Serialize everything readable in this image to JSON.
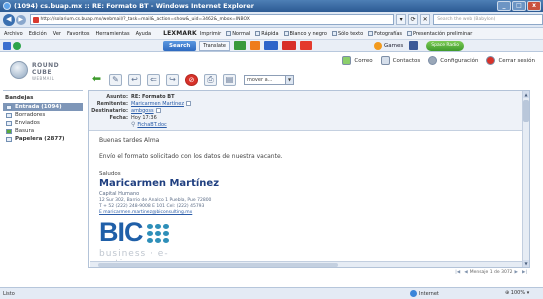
{
  "window": {
    "title": "(1094) cs.buap.mx :: RE: Formato BT - Windows Internet Explorer",
    "controls": [
      "_",
      "□",
      "x"
    ]
  },
  "address": {
    "url": "http://solarium.cs.buap.mx/webmail/?_task=mail&_action=show&_uid=3462&_mbox=INBOX",
    "search_placeholder": "Search the web (Babylon)"
  },
  "menu": {
    "items": [
      "Archivo",
      "Edición",
      "Ver",
      "Favoritos",
      "Herramientas",
      "Ayuda"
    ],
    "lexmark": "LEXMARK",
    "tools": [
      "Imprimir",
      "Normal",
      "Rápida",
      "Blanco y negro",
      "Sólo texto",
      "Fotografías",
      "Presentación preliminar"
    ]
  },
  "toolbar2": {
    "search_label": "Search",
    "translate_label": "Translate",
    "games_label": "Games",
    "radio_label": "Space Radio"
  },
  "webmail": {
    "logo_line1": "ROUND",
    "logo_line2": "CUBE",
    "logo_line3": "WEBMAIL",
    "nav": [
      "Correo",
      "Contactos",
      "Configuración",
      "Cerrar sesión"
    ],
    "move_placeholder": "mover a...",
    "folders_title": "Bandejas",
    "folders": [
      {
        "label": "Entrada (1094)",
        "selected": true,
        "bold": true
      },
      {
        "label": "Borradores",
        "selected": false,
        "bold": false
      },
      {
        "label": "Enviados",
        "selected": false,
        "bold": false
      },
      {
        "label": "Basura",
        "selected": false,
        "bold": false
      },
      {
        "label": "Papelera (2877)",
        "selected": false,
        "bold": true
      }
    ]
  },
  "message": {
    "subject_label": "Asunto:",
    "subject": "RE: Formato BT",
    "from_label": "Remitente:",
    "from": "Maricarmen Martínez",
    "to_label": "Destinatario:",
    "to": "ambgoss",
    "date_label": "Fecha:",
    "date": "Hoy 17:36",
    "attachment": "FichaBT.doc",
    "greeting": "Buenas tardes Alma",
    "body": "Envío el formato solicitado con los datos de nuestra vacante.",
    "closing": "Saludos",
    "sig_name": "Maricarmen Martínez",
    "sig_role": "Capital Humano",
    "sig_address": "12 Sur 302, Barrio de Analco  1 Puebla, Pue 72800",
    "sig_phone": "T + 52 (222) 248-9008 E 101  Cel: (222) 45793",
    "sig_email": "E maricarmen.martinez@biconsulting.mx",
    "logo_text": "BIC",
    "logo_tagline": "business · e-motion",
    "pager": "Mensaje 1 de 3072"
  },
  "statusbar": {
    "left": "Listo",
    "zone": "Internet",
    "zoom": "100%"
  }
}
